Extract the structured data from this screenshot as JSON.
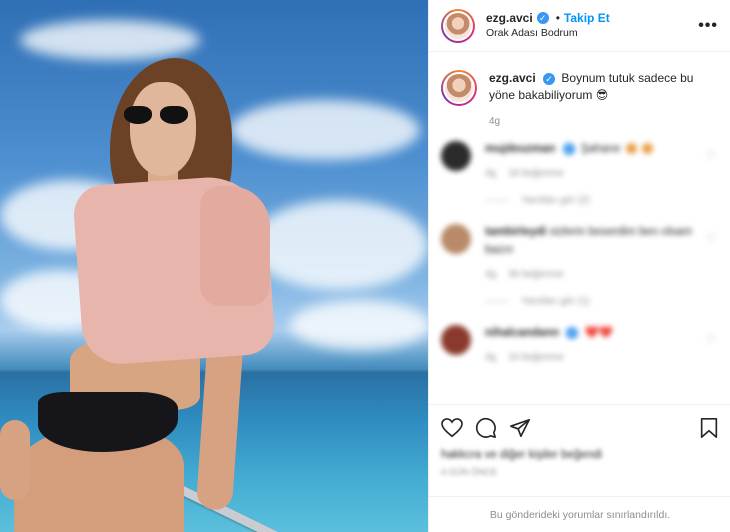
{
  "post": {
    "username": "ezg.avci",
    "verified_mark": "✓",
    "separator": "•",
    "follow_label": "Takip Et",
    "location": "Orak Adası Bodrum",
    "more_label": "•••",
    "caption_text": "Boynum tutuk sadece bu yöne bakabiliyorum 😎",
    "caption_time": "4g"
  },
  "comments": [
    {
      "user": "mujdeuzman",
      "text": "Şahane",
      "time": "4g",
      "likes": "18 beğenme",
      "replies": "Yanıtları gör (2)",
      "avatar_color": "#2b2b2b"
    },
    {
      "user": "tambirleydi",
      "text": "sizlerin beserdim ben olsam bazın",
      "time": "4g",
      "likes": "36 beğenme",
      "replies": "Yanıtları gör (1)",
      "avatar_color": "#b88a6a"
    },
    {
      "user": "nihalcandann",
      "text": "❤️❤️",
      "time": "4g",
      "likes": "16 beğenme",
      "replies": "",
      "avatar_color": "#8a3a2c"
    }
  ],
  "footer": {
    "likes_text": "hakkcra ve diğer kişiler beğendi",
    "date_text": "4 GÜN ÖNCE",
    "limited_text": "Bu gönderideki yorumlar sınırlandırıldı."
  },
  "icons": [
    "heart-icon",
    "comment-icon",
    "share-icon",
    "bookmark-icon"
  ],
  "colors": {
    "accent": "#0095f6",
    "verified": "#3897f0",
    "muted": "#8e8e8e"
  }
}
